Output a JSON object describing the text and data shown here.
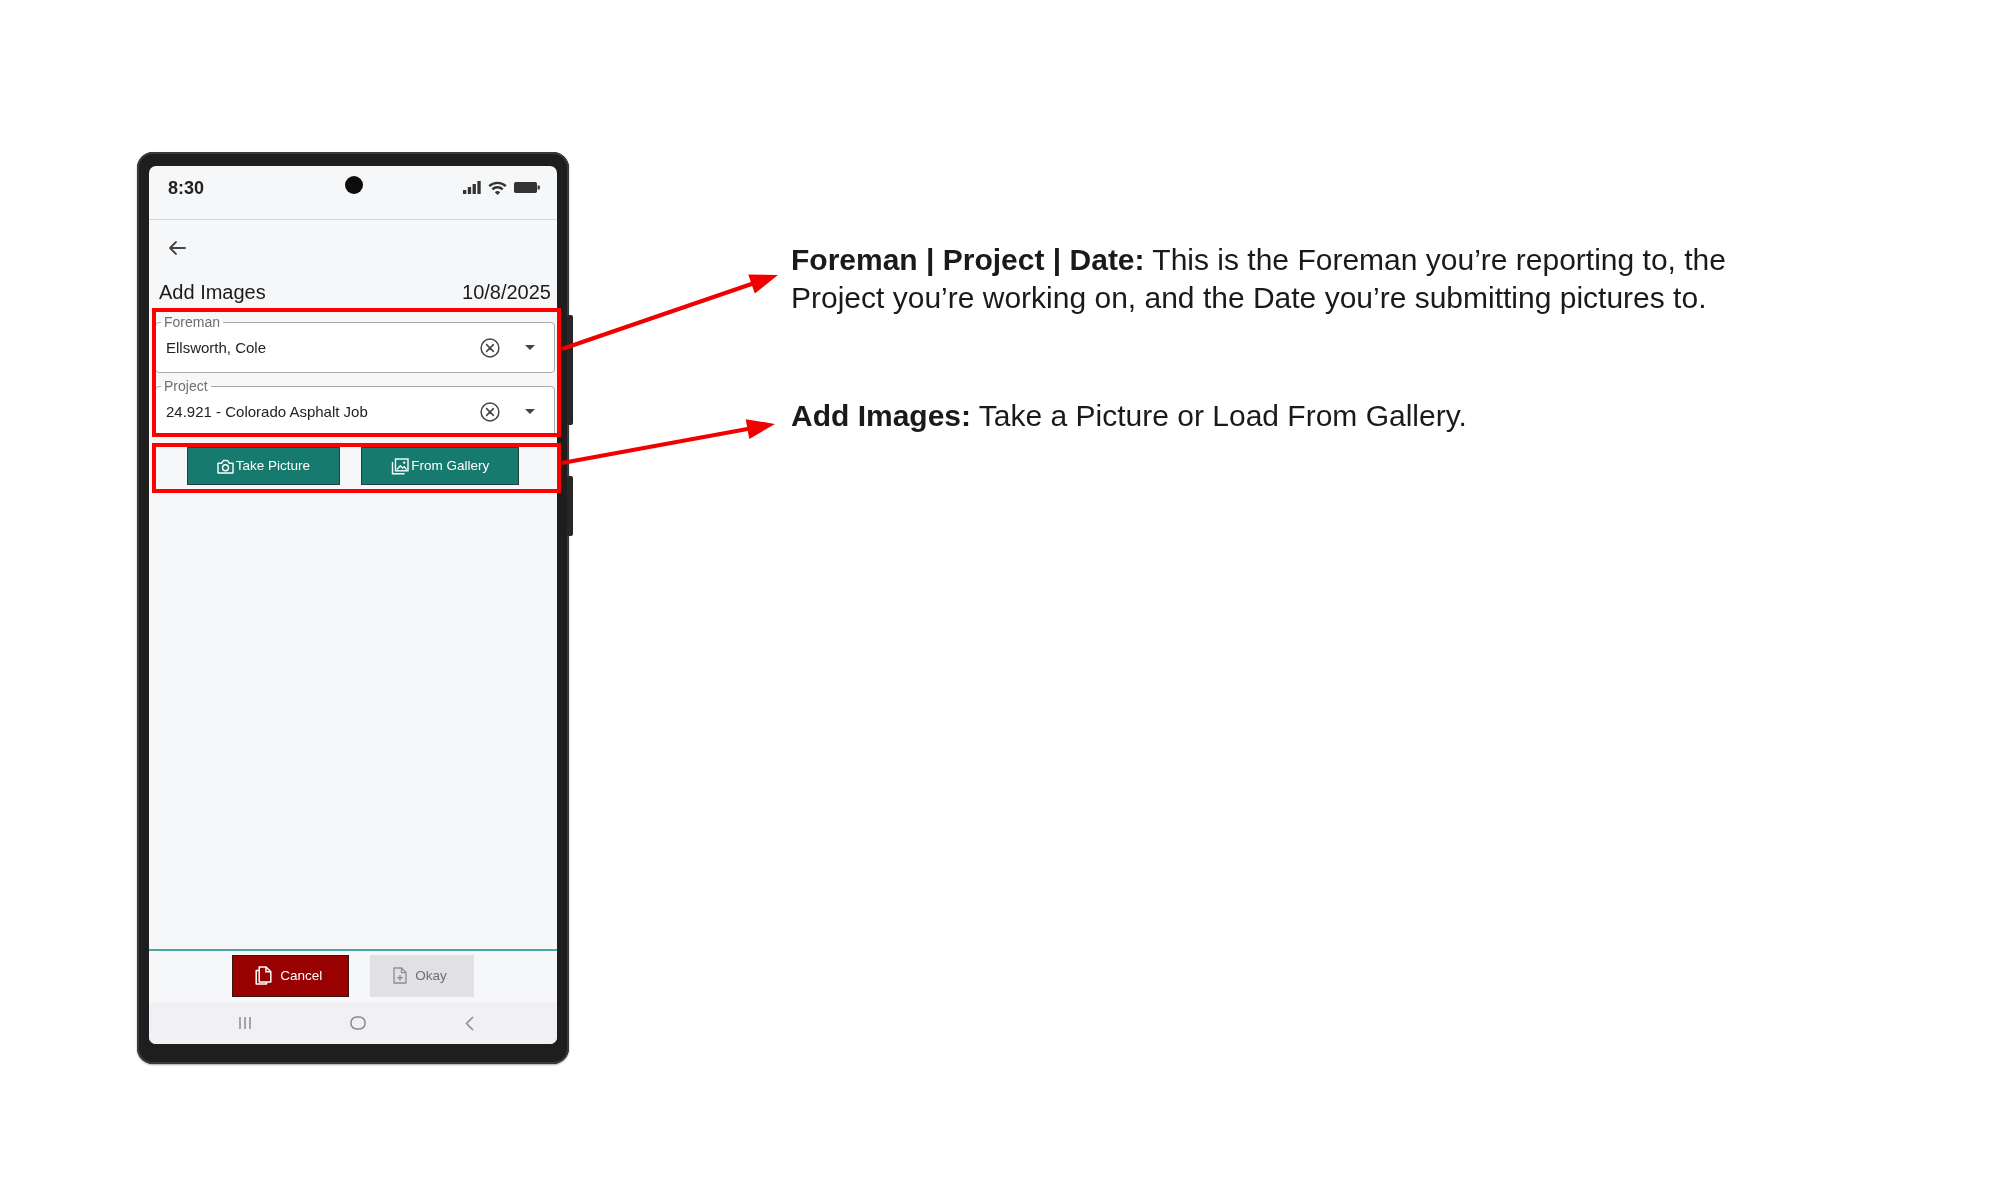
{
  "phone": {
    "status_bar": {
      "time": "8:30"
    },
    "header": {
      "title": "Add Images",
      "date": "10/8/2025"
    },
    "fields": [
      {
        "label": "Foreman",
        "value": "Ellsworth, Cole"
      },
      {
        "label": "Project",
        "value": "24.921 - Colorado Asphalt Job"
      }
    ],
    "actions": [
      {
        "label": "Take Picture",
        "kind": "camera"
      },
      {
        "label": "From Gallery",
        "kind": "gallery"
      }
    ],
    "footer_buttons": [
      {
        "label": "Cancel",
        "kind": "cancel",
        "disabled": false
      },
      {
        "label": "Okay",
        "kind": "okay",
        "disabled": true
      }
    ]
  },
  "annotations": [
    "**Foreman | Project | Date:** This is the Foreman you’re reporting to, the Project you’re working on, and the Date you’re submitting pictures to.",
    "**Add Images:** Take a Picture or Load From Gallery."
  ]
}
